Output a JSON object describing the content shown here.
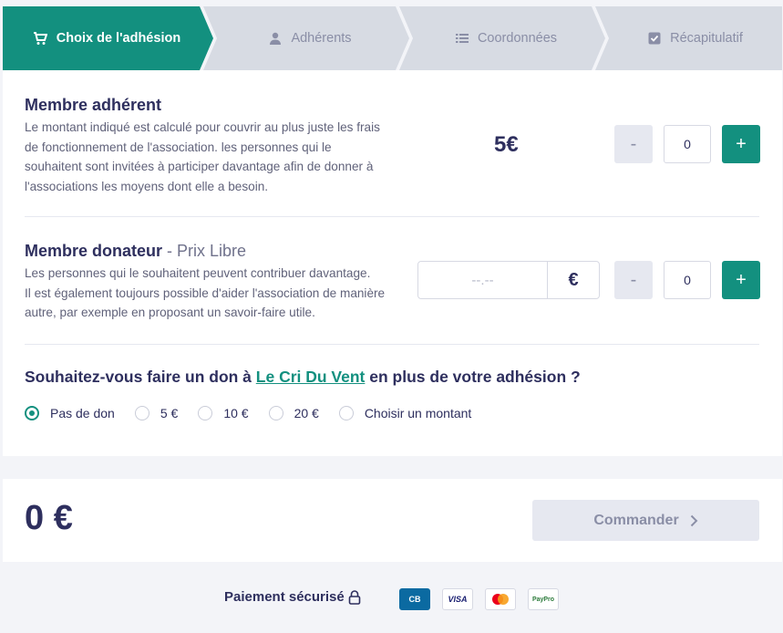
{
  "steps": [
    {
      "label": "Choix de l'adhésion",
      "icon": "cart-icon",
      "active": true
    },
    {
      "label": "Adhérents",
      "icon": "user-icon",
      "active": false
    },
    {
      "label": "Coordonnées",
      "icon": "list-icon",
      "active": false
    },
    {
      "label": "Récapitulatif",
      "icon": "check-square-icon",
      "active": false
    }
  ],
  "colors": {
    "accent": "#13907f",
    "text": "#2e2f5e",
    "muted": "#8a8ea6",
    "inactive_step": "#d7dbe3"
  },
  "membre_adherent": {
    "title": "Membre adhérent",
    "desc_lines": [
      "Le montant indiqué est calculé pour couvrir au plus juste les frais",
      "de fonctionnement de l'association. les personnes qui le",
      "souhaitent sont invitées à participer davantage afin de donner à",
      "l'associations les moyens dont elle a besoin."
    ],
    "price": "5€",
    "minus": "-",
    "qty": "0",
    "plus": "+"
  },
  "membre_donateur": {
    "title": "Membre donateur",
    "subtitle": " - Prix Libre",
    "desc_lines": [
      "Les personnes qui le souhaitent peuvent contribuer davantage.",
      "Il est également toujours possible d'aider l'association de manière",
      "autre, par exemple en proposant un savoir-faire utile."
    ],
    "amount_placeholder": "--.--",
    "currency": "€",
    "minus": "-",
    "qty": "0",
    "plus": "+"
  },
  "don": {
    "question_before": "Souhaitez-vous faire un don à ",
    "org_link": "Le Cri Du Vent",
    "question_after": " en plus de votre adhésion ?",
    "options": [
      "Pas de don",
      "5 €",
      "10 €",
      "20 €",
      "Choisir un montant"
    ],
    "selected": "Pas de don"
  },
  "footer": {
    "total": "0 €",
    "order_label": "Commander",
    "secure_label": "Paiement sécurisé",
    "payment_cards": [
      "CB",
      "VISA",
      "mastercard-icon",
      "PayPro"
    ]
  }
}
